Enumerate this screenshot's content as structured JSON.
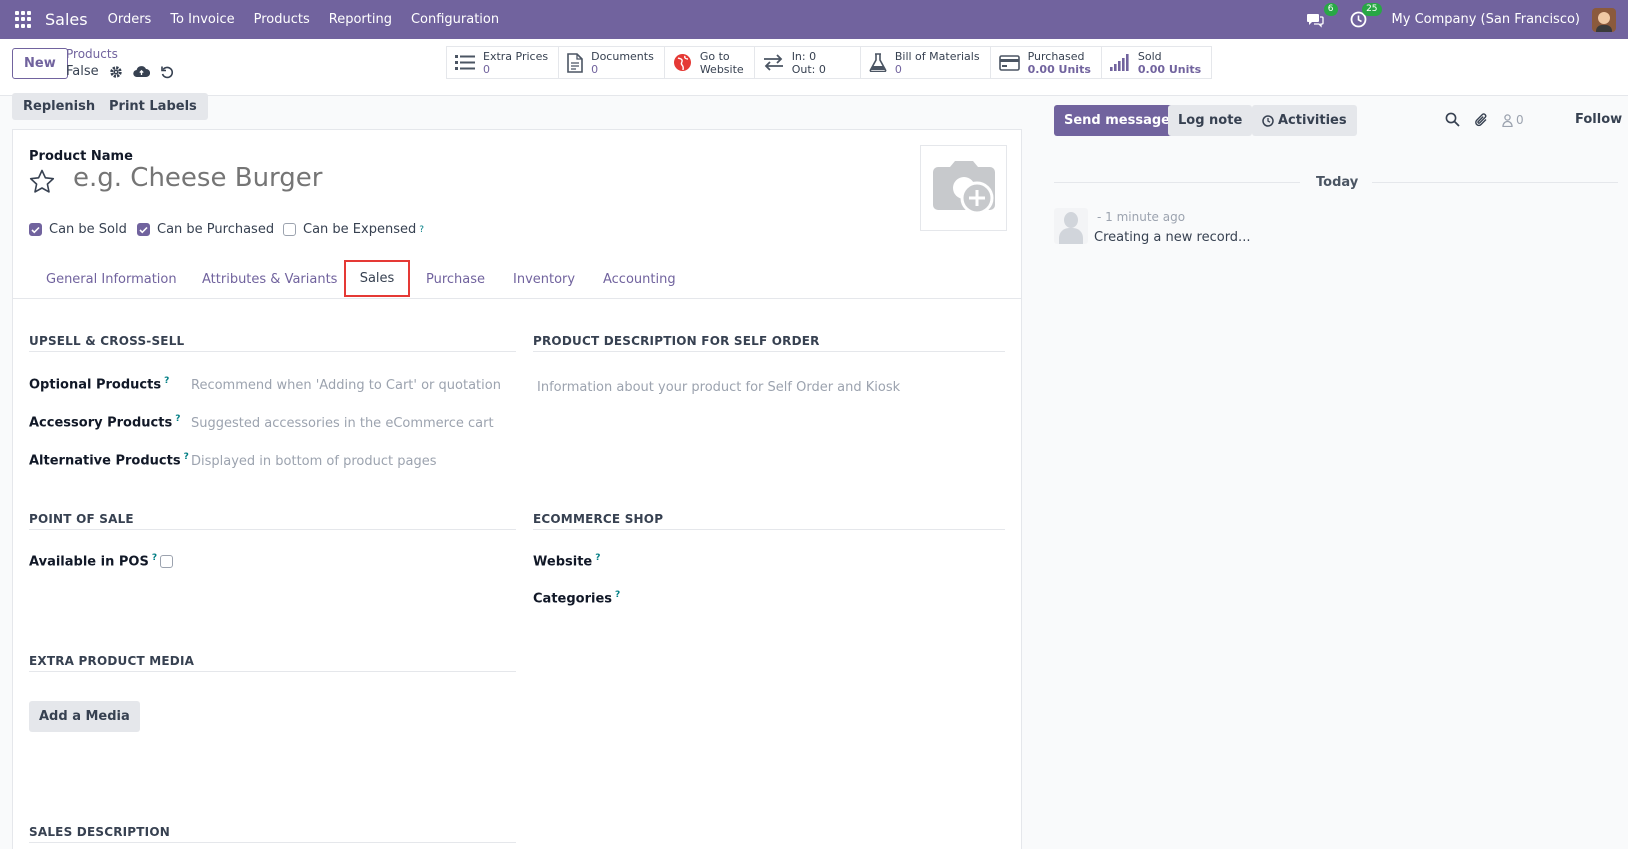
{
  "navbar": {
    "brand": "Sales",
    "menu": [
      "Orders",
      "To Invoice",
      "Products",
      "Reporting",
      "Configuration"
    ],
    "messages_badge": "6",
    "activities_badge": "25",
    "company": "My Company (San Francisco)",
    "background": "#71639e"
  },
  "control": {
    "new_label": "New",
    "breadcrumb": "Products",
    "record_name": "False"
  },
  "stats": [
    {
      "label": "Extra Prices",
      "value": "0",
      "icon": "list-icon"
    },
    {
      "label": "Documents",
      "value": "0",
      "icon": "document-icon"
    },
    {
      "label": "Go to",
      "value": "Website",
      "icon": "globe-icon"
    },
    {
      "label": "In: 0",
      "value": "Out: 0",
      "icon": "transfer-icon"
    },
    {
      "label": "Bill of Materials",
      "value": "0",
      "icon": "flask-icon"
    },
    {
      "label": "Purchased",
      "value": "0.00 Units",
      "icon": "credit-card-icon"
    },
    {
      "label": "Sold",
      "value": "0.00 Units",
      "icon": "bar-signal-icon"
    }
  ],
  "actions": {
    "replenish": "Replenish",
    "print_labels": "Print Labels"
  },
  "form": {
    "product_name_label": "Product Name",
    "product_name_placeholder": "e.g. Cheese Burger",
    "can_be_sold": "Can be Sold",
    "can_be_purchased": "Can be Purchased",
    "can_be_expensed": "Can be Expensed",
    "help": "?"
  },
  "tabs": [
    "General Information",
    "Attributes & Variants",
    "Sales",
    "Purchase",
    "Inventory",
    "Accounting"
  ],
  "sales_tab": {
    "upsell_title": "UPSELL & CROSS-SELL",
    "optional_label": "Optional Products",
    "optional_placeholder": "Recommend when 'Adding to Cart' or quotation",
    "accessory_label": "Accessory Products",
    "accessory_placeholder": "Suggested accessories in the eCommerce cart",
    "alternative_label": "Alternative Products",
    "alternative_placeholder": "Displayed in bottom of product pages",
    "self_order_title": "PRODUCT DESCRIPTION FOR SELF ORDER",
    "self_order_placeholder": "Information about your product for Self Order and Kiosk",
    "pos_title": "POINT OF SALE",
    "available_pos_label": "Available in POS",
    "ecommerce_title": "ECOMMERCE SHOP",
    "website_label": "Website",
    "categories_label": "Categories",
    "extra_media_title": "EXTRA PRODUCT MEDIA",
    "add_media": "Add a Media",
    "sales_desc_title": "SALES DESCRIPTION"
  },
  "chatter": {
    "send_message": "Send message",
    "log_note": "Log note",
    "activities": "Activities",
    "followers_count": "0",
    "follow": "Follow",
    "today": "Today",
    "message_time": "- 1 minute ago",
    "message_body": "Creating a new record..."
  }
}
